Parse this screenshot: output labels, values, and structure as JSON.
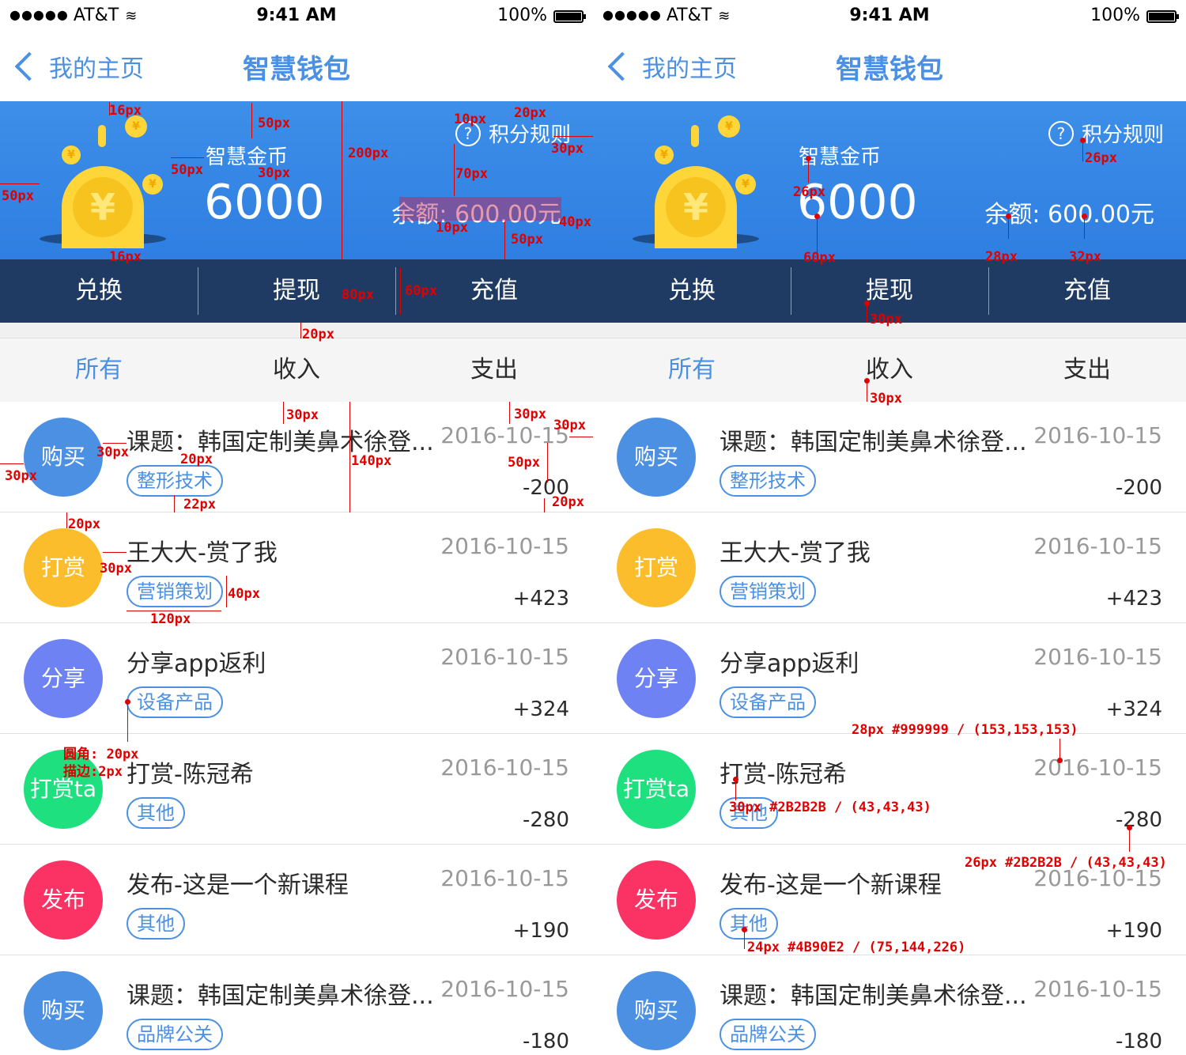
{
  "status_bar": {
    "carrier": "AT&T",
    "signal_dots": "●●●●●",
    "time": "9:41 AM",
    "battery": "100%"
  },
  "nav": {
    "back_label": "我的主页",
    "title": "智慧钱包"
  },
  "banner": {
    "coin_label": "智慧金币",
    "coin_value": "6000",
    "rules_label": "积分规则",
    "rules_icon": "?",
    "balance": "余额: 600.00元",
    "coin_symbol": "¥"
  },
  "actions": [
    "兑换",
    "提现",
    "充值"
  ],
  "tabs": [
    {
      "label": "所有",
      "active": true
    },
    {
      "label": "收入",
      "active": false
    },
    {
      "label": "支出",
      "active": false
    }
  ],
  "transactions": [
    {
      "avatar": "购买",
      "color": "#4b90e2",
      "title": "课题：韩国定制美鼻术徐登...",
      "tag": "整形技术",
      "date": "2016-10-15",
      "amount": "-200"
    },
    {
      "avatar": "打赏",
      "color": "#fbbd2c",
      "title": "王大大-赏了我",
      "tag": "营销策划",
      "date": "2016-10-15",
      "amount": "+423"
    },
    {
      "avatar": "分享",
      "color": "#6e82f3",
      "title": "分享app返利",
      "tag": "设备产品",
      "date": "2016-10-15",
      "amount": "+324"
    },
    {
      "avatar": "打赏ta",
      "color": "#1fe07f",
      "title": "打赏-陈冠希",
      "tag": "其他",
      "date": "2016-10-15",
      "amount": "-280"
    },
    {
      "avatar": "发布",
      "color": "#fb3365",
      "title": "发布-这是一个新课程",
      "tag": "其他",
      "date": "2016-10-15",
      "amount": "+190"
    },
    {
      "avatar": "购买",
      "color": "#4b90e2",
      "title": "课题：韩国定制美鼻术徐登...",
      "tag": "品牌公关",
      "date": "2016-10-15",
      "amount": "-180"
    }
  ],
  "annotations": {
    "m16": "16px",
    "m50": "50px",
    "m200": "200px",
    "m10": "10px",
    "m20": "20px",
    "m30": "30px",
    "m70": "70px",
    "m40": "40px",
    "m80": "80px",
    "m60": "60px",
    "m140": "140px",
    "m22": "22px",
    "m120": "120px",
    "m26": "26px",
    "m28": "28px",
    "m32": "32px",
    "radius": "圆角: 20px",
    "stroke": "描边:2px",
    "date_spec": "28px #999999 / (153,153,153)",
    "title_spec": "30px #2B2B2B / (43,43,43)",
    "amount_spec": "26px #2B2B2B / (43,43,43)",
    "tag_spec": "24px #4B90E2 / (75,144,226)"
  }
}
